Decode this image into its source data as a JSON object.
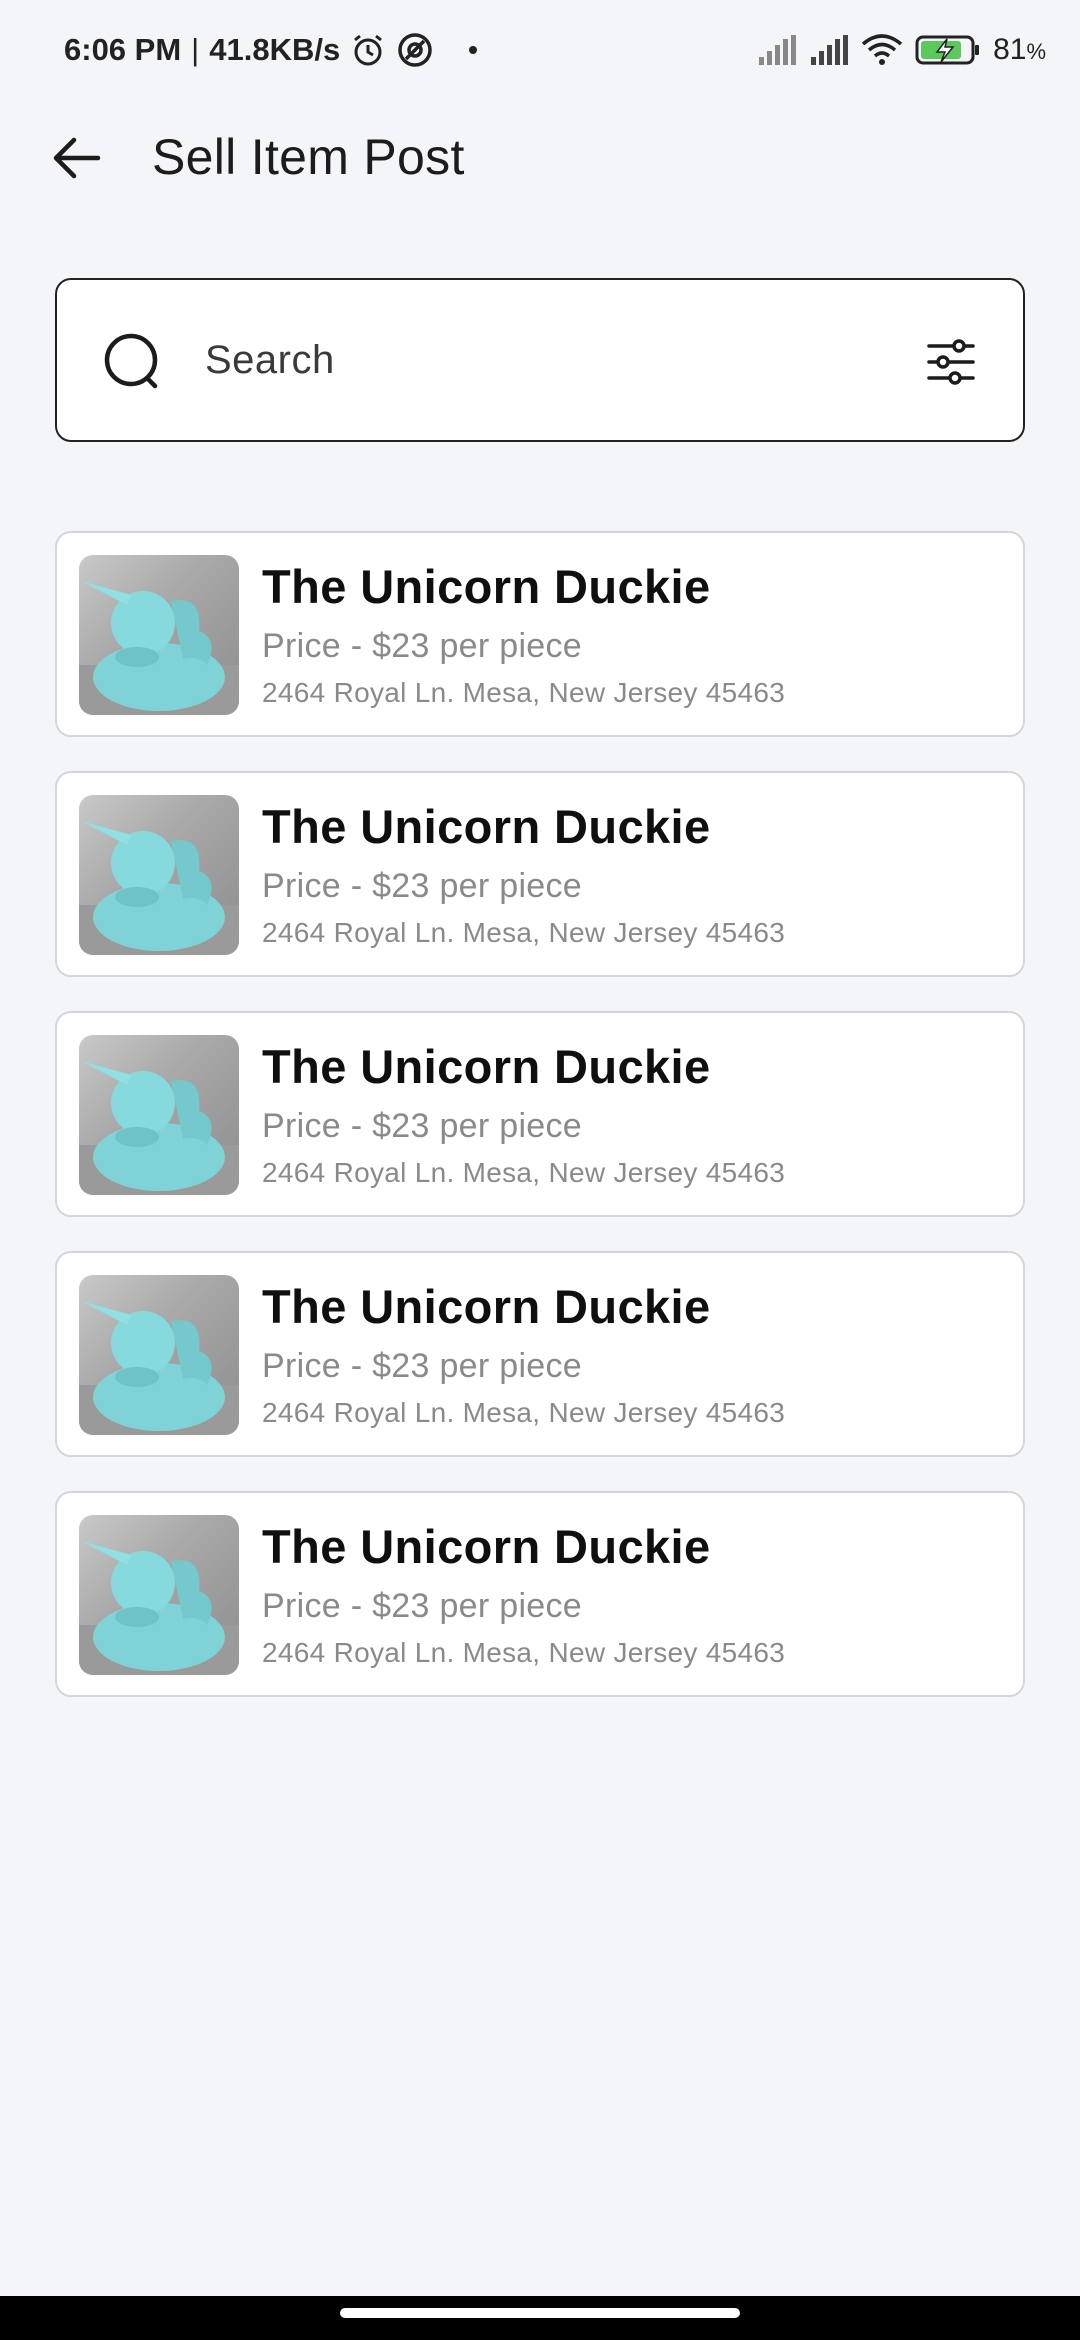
{
  "status_bar": {
    "time": "6:06 PM",
    "separator": "|",
    "network_speed": "41.8KB/s",
    "battery_percent": "81",
    "battery_unit": "%",
    "icons": [
      "alarm-icon",
      "vpn-icon",
      "dot-icon",
      "signal-icon",
      "signal-icon",
      "wifi-icon",
      "battery-charging-icon"
    ]
  },
  "app_bar": {
    "title": "Sell Item Post",
    "back_icon": "arrow-left-icon"
  },
  "search": {
    "placeholder": "Search",
    "icon": "search-icon",
    "filter_icon": "filter-sliders-icon"
  },
  "items": [
    {
      "title": "The Unicorn Duckie",
      "price": "Price - $23 per piece",
      "address": "2464 Royal Ln. Mesa, New Jersey 45463"
    },
    {
      "title": "The Unicorn Duckie",
      "price": "Price - $23 per piece",
      "address": "2464 Royal Ln. Mesa, New Jersey 45463"
    },
    {
      "title": "The Unicorn Duckie",
      "price": "Price - $23 per piece",
      "address": "2464 Royal Ln. Mesa, New Jersey 45463"
    },
    {
      "title": "The Unicorn Duckie",
      "price": "Price - $23 per piece",
      "address": "2464 Royal Ln. Mesa, New Jersey 45463"
    },
    {
      "title": "The Unicorn Duckie",
      "price": "Price - $23 per piece",
      "address": "2464 Royal Ln. Mesa, New Jersey 45463"
    }
  ],
  "colors": {
    "background": "#f4f5f9",
    "card": "#ffffff",
    "card_border": "#d5d6da",
    "title_text": "#0f0f0f",
    "secondary_text": "#8a8a8a",
    "duck": "#7fd3d6"
  }
}
